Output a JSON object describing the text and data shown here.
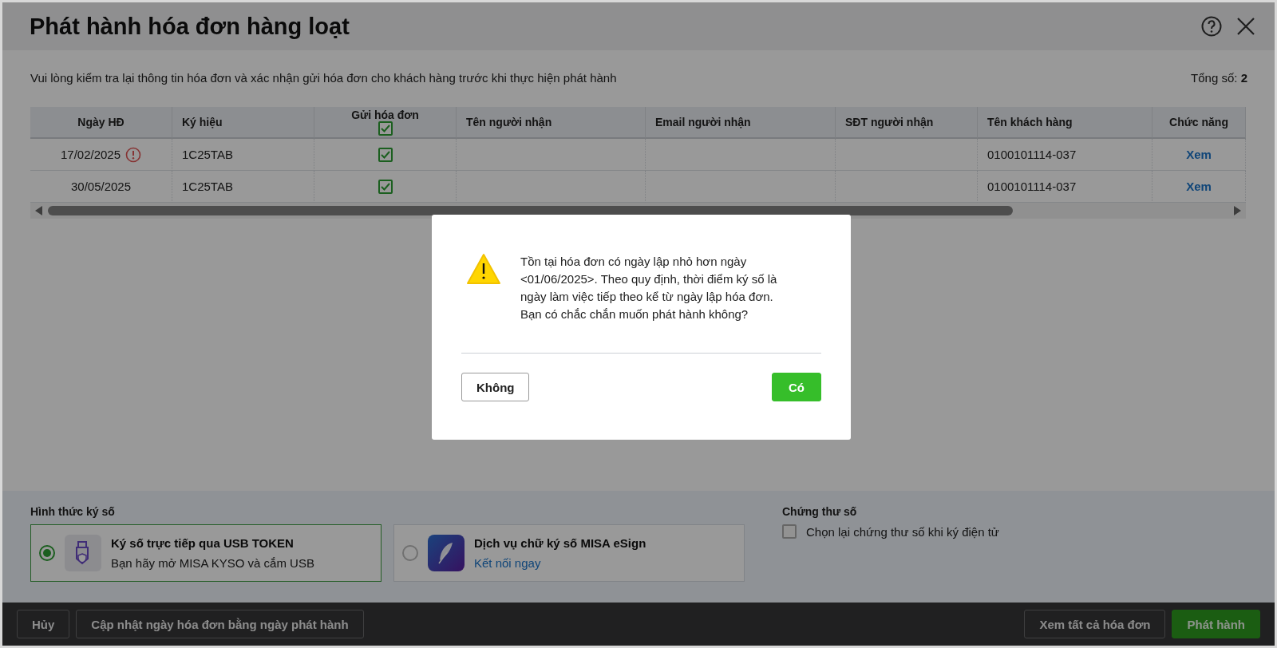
{
  "window": {
    "title": "Phát hành hóa đơn hàng loạt"
  },
  "instruction": "Vui lòng kiểm tra lại thông tin hóa đơn và xác nhận gửi hóa đơn cho khách hàng trước khi thực hiện phát hành",
  "total": "Tổng số: **2**",
  "table": {
    "columns": [
      {
        "label": "Ngày HĐ"
      },
      {
        "label": "Ký hiệu"
      },
      {
        "label": "Gửi hóa đơn",
        "checked": true
      },
      {
        "label": "Tên người nhận"
      },
      {
        "label": "Email người nhận"
      },
      {
        "label": "SĐT người nhận"
      },
      {
        "label": "Tên khách hàng"
      },
      {
        "label": "Chức năng"
      }
    ],
    "rows": [
      {
        "date": "17/02/2025",
        "warning": true,
        "symbol": "1C25TAB",
        "send": true,
        "customer": "0100101114-037",
        "action": "Xem"
      },
      {
        "date": "30/05/2025",
        "warning": false,
        "symbol": "1C25TAB",
        "send": true,
        "customer": "0100101114-037",
        "action": "Xem"
      }
    ]
  },
  "signing": {
    "label": "Hình thức ký số",
    "options": [
      {
        "kind": "usb",
        "title": "Ký số trực tiếp qua USB TOKEN",
        "subtitle": "Bạn hãy mở MISA KYSO và cắm USB",
        "selected": true
      },
      {
        "kind": "esign",
        "title": "Dịch vụ chữ ký số MISA eSign",
        "link": "Kết nối ngay",
        "selected": false
      }
    ]
  },
  "certificate": {
    "label": "Chứng thư số",
    "option": {
      "label": "Chọn lại chứng thư số khi ký điện tử",
      "checked": false
    }
  },
  "footer": {
    "left": [
      "Hủy",
      "Cập nhật ngày hóa đơn bằng ngày phát hành"
    ],
    "right": [
      {
        "label": "Xem tất cả hóa đơn",
        "kind": "secondary"
      },
      {
        "label": "Phát hành",
        "kind": "primary"
      }
    ]
  },
  "dialog": {
    "message": "Tồn tại hóa đơn có ngày lập nhỏ hơn ngày <01/06/2025>. Theo quy định, thời điểm ký số là ngày làm việc tiếp theo kể từ ngày lập hóa đơn. Bạn có chắc chắn muốn phát hành không?",
    "buttons": [
      {
        "label": "Không",
        "kind": "secondary"
      },
      {
        "label": "Có",
        "kind": "primary"
      }
    ]
  }
}
